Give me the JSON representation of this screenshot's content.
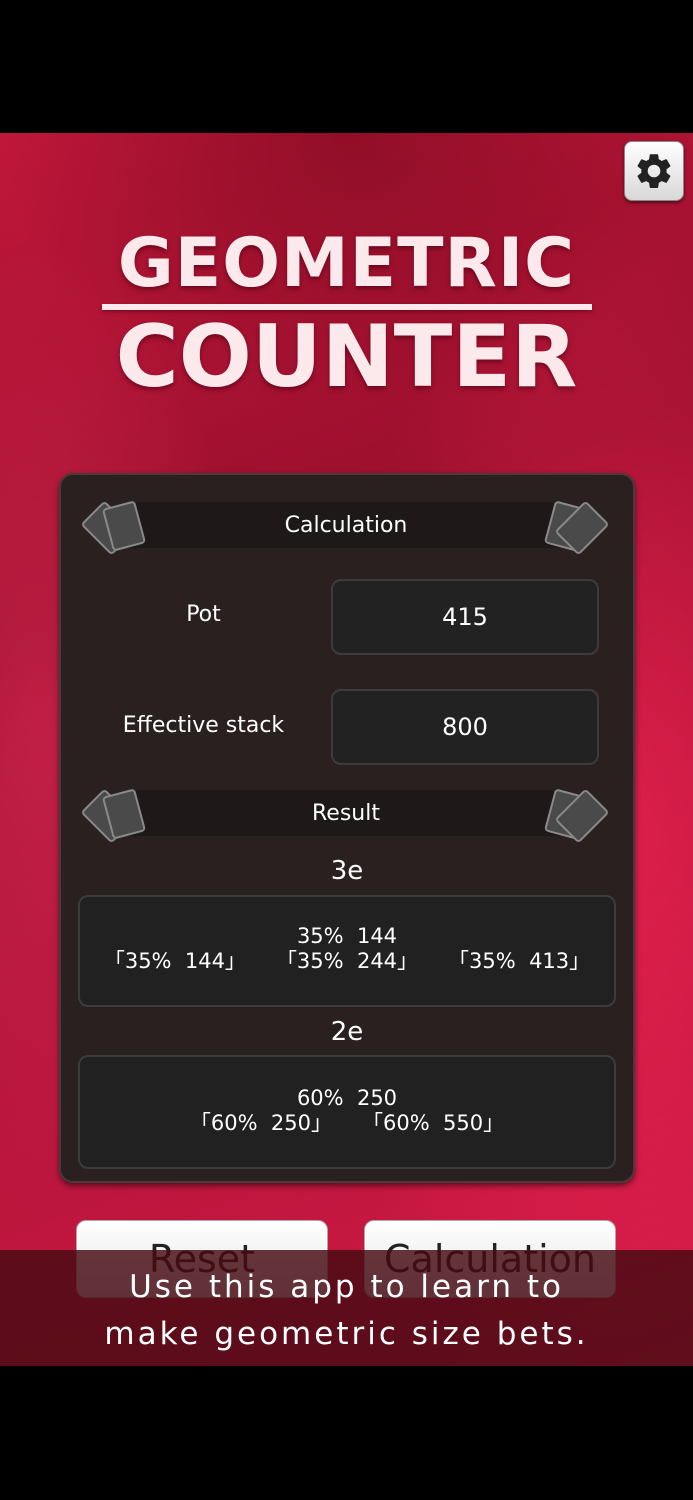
{
  "app": {
    "logo_line1": "GEOMETRIC",
    "logo_line2": "COUNTER",
    "settings_icon": "gear-icon"
  },
  "calculation": {
    "section_title": "Calculation",
    "pot_label": "Pot",
    "pot_value": "415",
    "stack_label": "Effective stack",
    "stack_value": "800"
  },
  "result": {
    "section_title": "Result",
    "groups": [
      {
        "label": "3e",
        "summary": "35%  144",
        "streets": [
          "「35%  144」",
          "「35%  244」",
          "「35%  413」"
        ]
      },
      {
        "label": "2e",
        "summary": "60%  250",
        "streets": [
          "「60%  250」",
          "「60%  550」"
        ]
      }
    ]
  },
  "buttons": {
    "reset_label": "Reset",
    "calculation_label": "Calculation"
  },
  "banner": {
    "line1": "Use this app to learn to",
    "line2": "make geometric size bets."
  },
  "colors": {
    "background": "#b5143a",
    "panel": "#2b2020",
    "value_box": "#222222"
  }
}
